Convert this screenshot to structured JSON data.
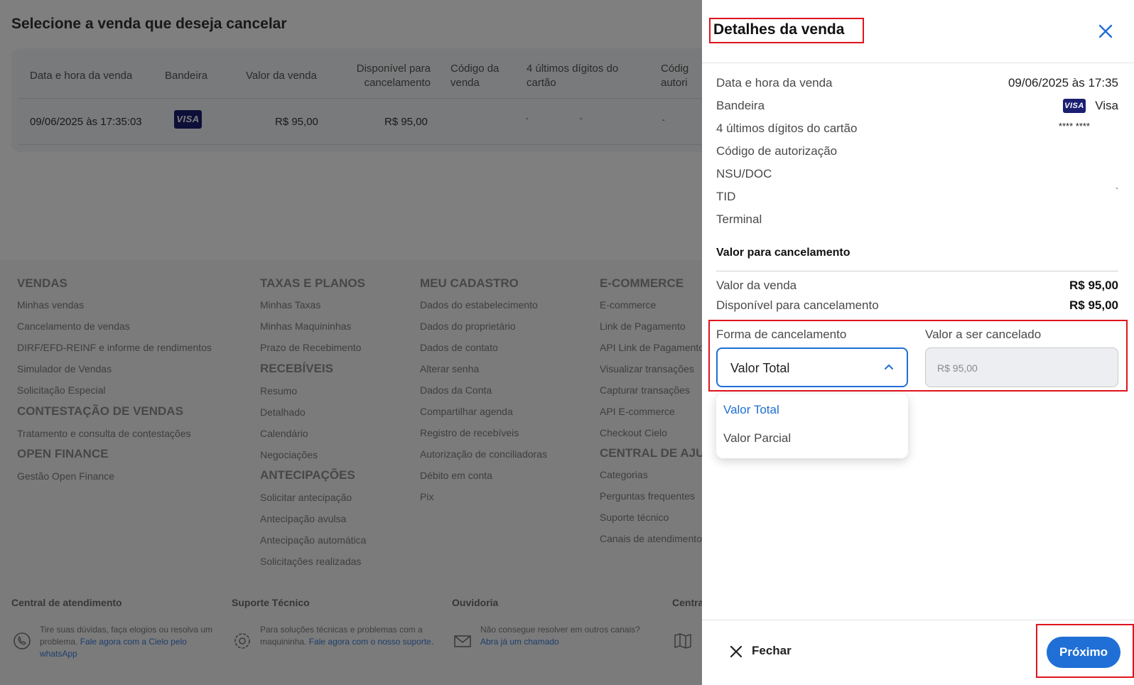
{
  "page": {
    "title": "Selecione a venda que deseja cancelar",
    "table": {
      "headers": [
        "Data e hora da venda",
        "Bandeira",
        "Valor da venda",
        "Disponível para cancelamento",
        "Código da venda",
        "4 últimos dígitos do cartão",
        "Códig autori"
      ],
      "row": {
        "date": "09/06/2025 às 17:35:03",
        "brand": "VISA",
        "value": "R$ 95,00",
        "available": "R$ 95,00",
        "code": "-",
        "digits": "-",
        "auth": "-"
      }
    }
  },
  "footer": {
    "columns": [
      {
        "sections": [
          {
            "title": "VENDAS",
            "links": [
              "Minhas vendas",
              "Cancelamento de vendas",
              "DIRF/EFD-REINF e informe de rendimentos",
              "Simulador de Vendas",
              "Solicitação Especial"
            ]
          },
          {
            "title": "CONTESTAÇÃO DE VENDAS",
            "links": [
              "Tratamento e consulta de contestações"
            ]
          },
          {
            "title": "OPEN FINANCE",
            "links": [
              "Gestão Open Finance"
            ]
          }
        ]
      },
      {
        "sections": [
          {
            "title": "TAXAS E PLANOS",
            "links": [
              "Minhas Taxas",
              "Minhas Maquininhas",
              "Prazo de Recebimento"
            ]
          },
          {
            "title": "RECEBÍVEIS",
            "links": [
              "Resumo",
              "Detalhado",
              "Calendário",
              "Negociações"
            ]
          },
          {
            "title": "ANTECIPAÇÕES",
            "links": [
              "Solicitar antecipação",
              "Antecipação avulsa",
              "Antecipação automática",
              "Solicitações realizadas"
            ]
          }
        ]
      },
      {
        "sections": [
          {
            "title": "MEU CADASTRO",
            "links": [
              "Dados do estabelecimento",
              "Dados do proprietário",
              "Dados de contato",
              "Alterar senha",
              "Dados da Conta",
              "Compartilhar agenda",
              "Registro de recebíveis",
              "Autorização de conciliadoras",
              "Débito em conta",
              "Pix"
            ]
          }
        ]
      },
      {
        "sections": [
          {
            "title": "E-COMMERCE",
            "links": [
              "E-commerce",
              "Link de Pagamento",
              "API Link de Pagamento",
              "Visualizar transações",
              "Capturar transações",
              "API E-commerce",
              "Checkout Cielo"
            ]
          },
          {
            "title": "CENTRAL DE AJU",
            "links": [
              "Categorias",
              "Perguntas frequentes",
              "Suporte técnico",
              "Canais de atendimento"
            ]
          }
        ]
      }
    ],
    "support": [
      {
        "title": "Central de atendimento",
        "text": "Tire suas dúvidas, faça elogios ou resolva um problema.",
        "link": "Fale agora com a Cielo pelo whatsApp"
      },
      {
        "title": "Suporte Técnico",
        "text": "Para soluções técnicas e problemas com a maquininha.",
        "link": "Fale agora com o nosso suporte."
      },
      {
        "title": "Ouvidoria",
        "text": "Não consegue resolver em outros canais?",
        "link": "Abra já um chamado"
      },
      {
        "title": "Centra",
        "text": "",
        "link": ""
      }
    ]
  },
  "drawer": {
    "title": "Detalhes da venda",
    "details": [
      {
        "label": "Data e hora da venda",
        "value": "09/06/2025 às 17:35"
      },
      {
        "label": "Bandeira",
        "value": "Visa"
      },
      {
        "label": "4 últimos dígitos do cartão",
        "value": "**** ****"
      },
      {
        "label": "Código de autorização",
        "value": ""
      },
      {
        "label": "NSU/DOC",
        "value": ""
      },
      {
        "label": "TID",
        "value": "`"
      },
      {
        "label": "Terminal",
        "value": ""
      }
    ],
    "visa_badge": "VISA",
    "section_title": "Valor para cancelamento",
    "amounts": [
      {
        "label": "Valor da venda",
        "value": "R$ 95,00"
      },
      {
        "label": "Disponível para cancelamento",
        "value": "R$ 95,00"
      }
    ],
    "form": {
      "method_label": "Forma de cancelamento",
      "method_value": "Valor Total",
      "amount_label": "Valor a ser cancelado",
      "amount_value": "R$ 95,00",
      "options": [
        "Valor Total",
        "Valor Parcial"
      ]
    },
    "close_label": "Fechar",
    "next_label": "Próximo"
  },
  "colors": {
    "accent": "#1f6fd6",
    "highlight": "#e0141e",
    "visa": "#1a1f71"
  }
}
